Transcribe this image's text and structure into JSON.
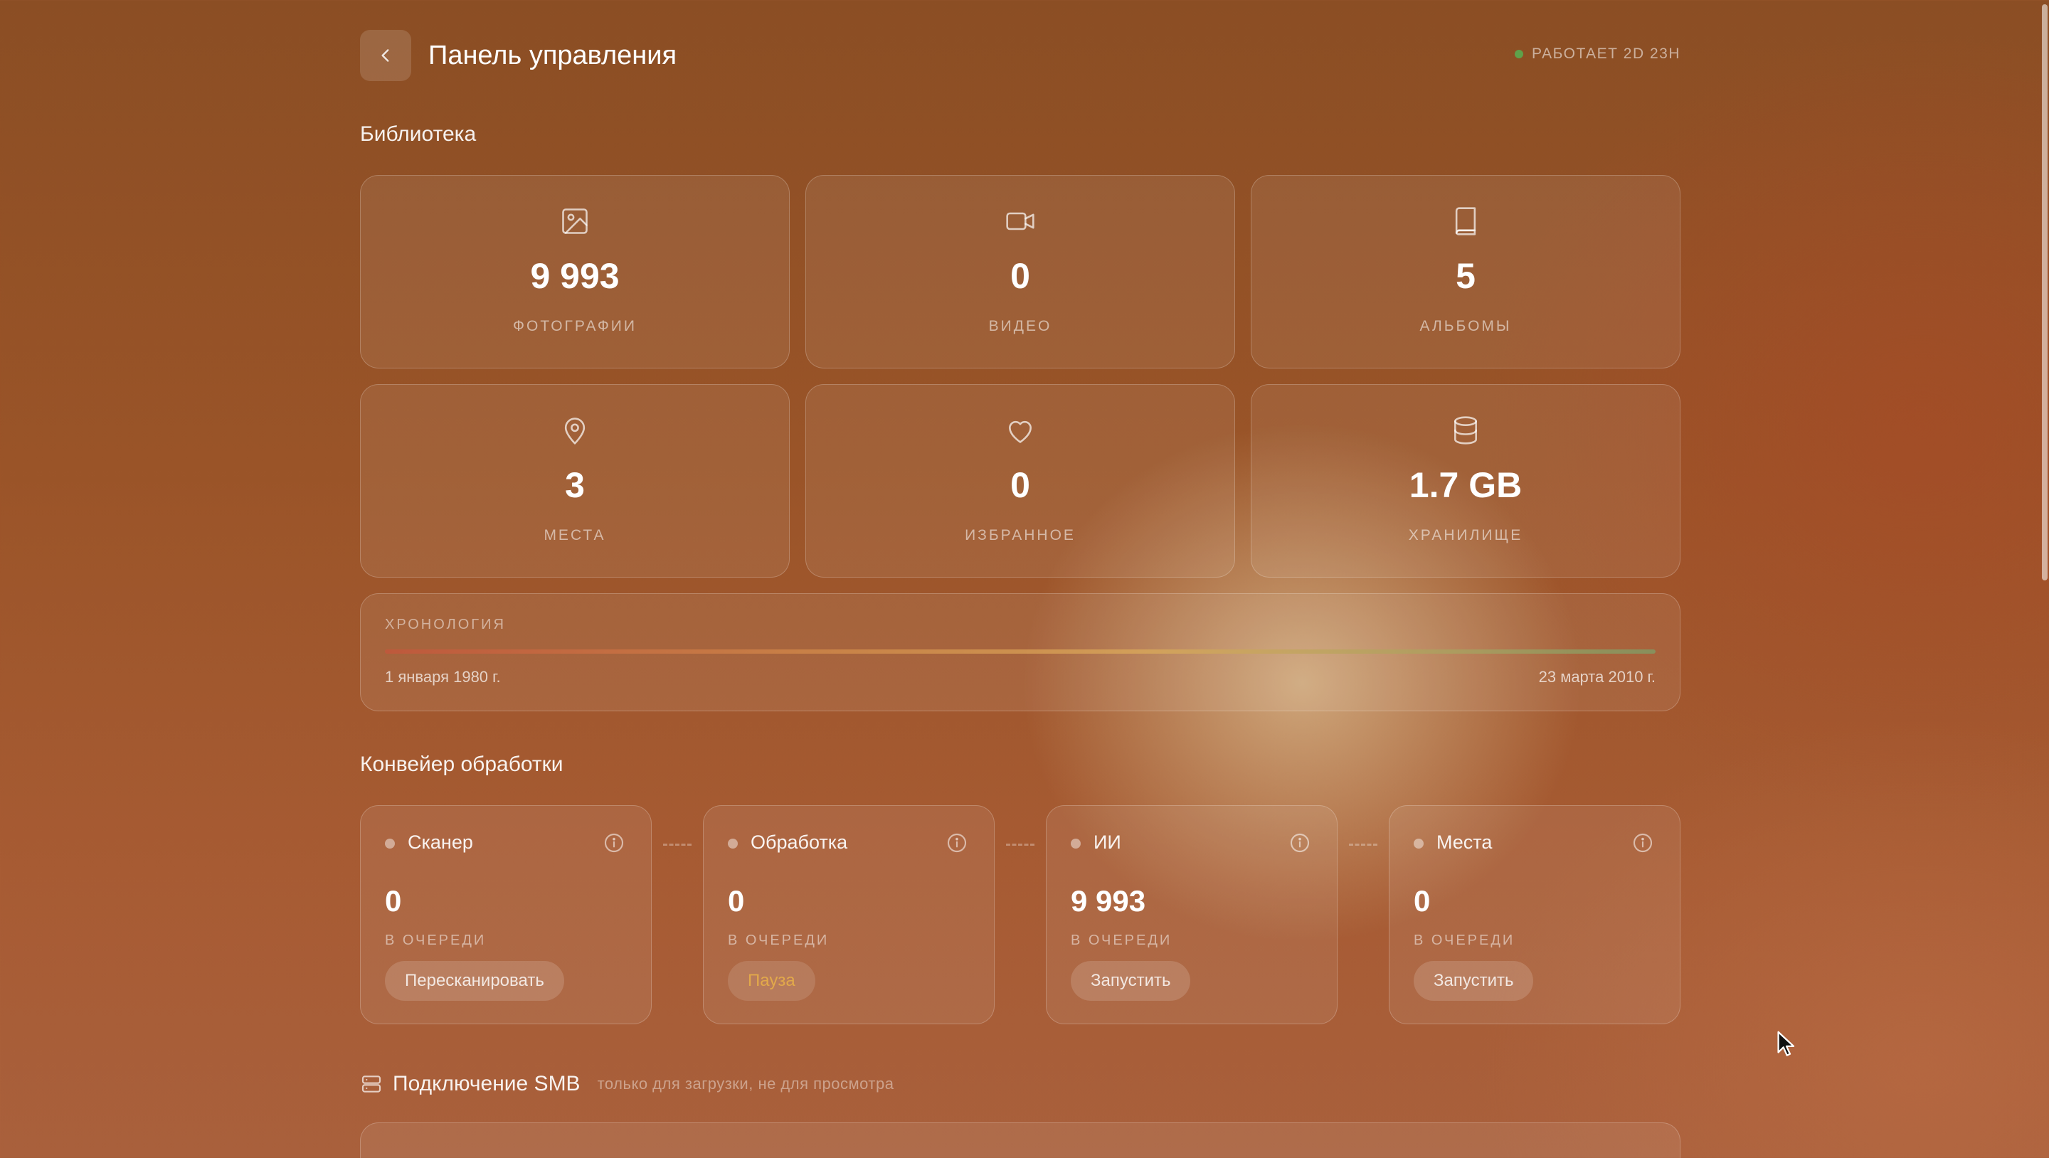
{
  "header": {
    "title": "Панель управления",
    "status": "РАБОТАЕТ 2D 23H",
    "status_color": "#5fa14a"
  },
  "library": {
    "title": "Библиотека",
    "stats": [
      {
        "icon": "image-icon",
        "value": "9 993",
        "label": "ФОТОГРАФИИ"
      },
      {
        "icon": "video-icon",
        "value": "0",
        "label": "ВИДЕО"
      },
      {
        "icon": "book-icon",
        "value": "5",
        "label": "АЛЬБОМЫ"
      },
      {
        "icon": "map-pin-icon",
        "value": "3",
        "label": "МЕСТА"
      },
      {
        "icon": "heart-icon",
        "value": "0",
        "label": "ИЗБРАННОЕ"
      },
      {
        "icon": "database-icon",
        "value": "1.7 GB",
        "label": "ХРАНИЛИЩЕ"
      }
    ]
  },
  "timeline": {
    "label": "ХРОНОЛОГИЯ",
    "start": "1 января 1980 г.",
    "end": "23 марта 2010 г."
  },
  "pipeline": {
    "title": "Конвейер обработки",
    "stages": [
      {
        "name": "Сканер",
        "value": "0",
        "sub": "В ОЧЕРЕДИ",
        "button": "Пересканировать"
      },
      {
        "name": "Обработка",
        "value": "0",
        "sub": "В ОЧЕРЕДИ",
        "button": "Пауза"
      },
      {
        "name": "ИИ",
        "value": "9 993",
        "sub": "В ОЧЕРЕДИ",
        "button": "Запустить"
      },
      {
        "name": "Места",
        "value": "0",
        "sub": "В ОЧЕРЕДИ",
        "button": "Запустить"
      }
    ]
  },
  "smb": {
    "title": "Подключение SMB",
    "note": "только для загрузки, не для просмотра"
  }
}
